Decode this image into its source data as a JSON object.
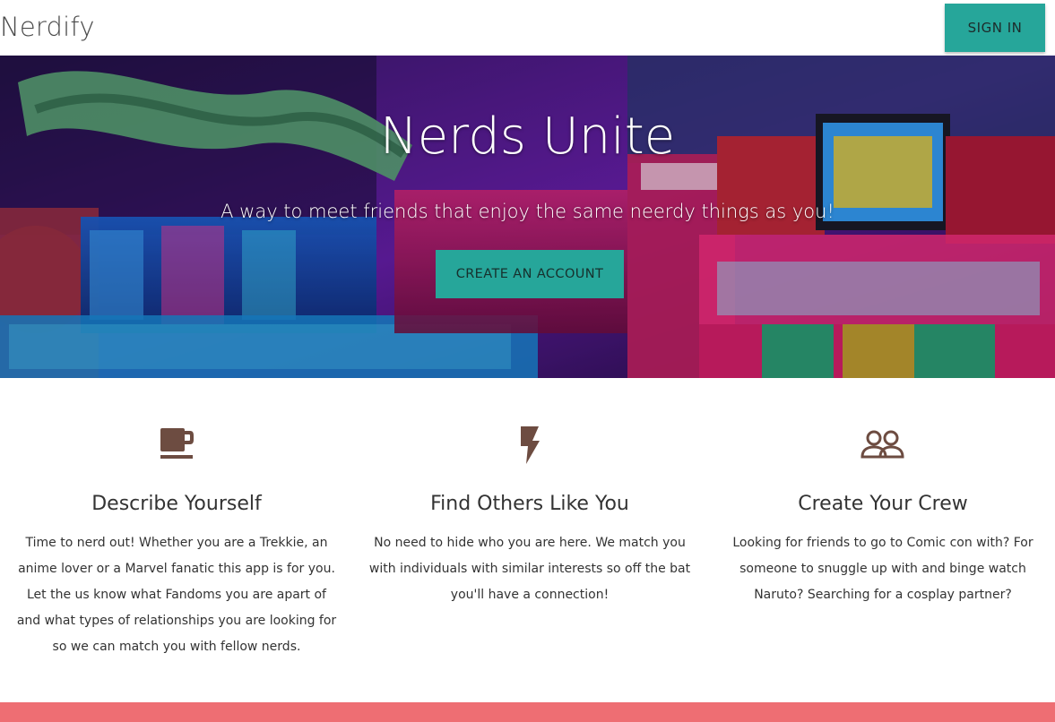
{
  "header": {
    "brand": "Nerdify",
    "signin_label": "SIGN IN"
  },
  "hero": {
    "title": "Nerds Unite",
    "subtitle": "A way to meet friends that enjoy the same neerdy things as you!",
    "cta_label": "CREATE AN ACCOUNT"
  },
  "features": [
    {
      "icon": "coffee-cup-icon",
      "title": "Describe Yourself",
      "text": "Time to nerd out! Whether you are a Trekkie, an anime lover or a Marvel fanatic this app is for you. Let the us know what Fandoms you are apart of and what types of relationships you are looking for so we can match you with fellow nerds."
    },
    {
      "icon": "lightning-bolt-icon",
      "title": "Find Others Like You",
      "text": "No need to hide who you are here. We match you with individuals with similar interests so off the bat you'll have a connection!"
    },
    {
      "icon": "people-group-icon",
      "title": "Create Your Crew",
      "text": "Looking for friends to go to Comic con with? For someone to snuggle up with and binge watch Naruto? Searching for a cosplay partner?"
    }
  ],
  "colors": {
    "accent": "#26a69a",
    "icon": "#6d4c41",
    "footer": "#ee6e73"
  }
}
